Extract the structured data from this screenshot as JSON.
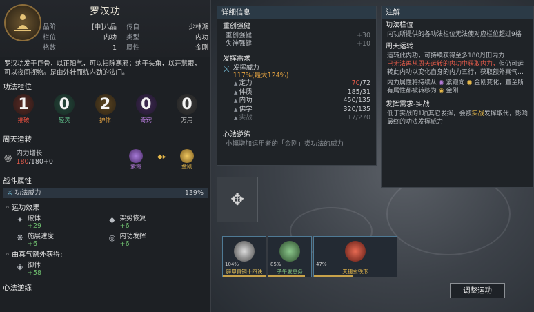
{
  "skill": {
    "title": "罗汉功",
    "attrs": [
      {
        "k": "品阶",
        "v": "[中]八品",
        "k2": "传自",
        "v2": "少林派"
      },
      {
        "k": "栏位",
        "v": "内功",
        "k2": "类型",
        "v2": "内功"
      },
      {
        "k": "格数",
        "v": "1",
        "k2": "属性",
        "v2": "金刚"
      }
    ],
    "desc": "罗汉功发于巨骨，以正阳气，可以扫除寒邪；纳于头角，以开慧眼，可以夜间视物。是由外壮而练内劲的法门。"
  },
  "slots_section": "功法栏位",
  "slots": [
    {
      "num": "1",
      "label": "摧破",
      "color": "#d84a3c"
    },
    {
      "num": "0",
      "label": "轻灵",
      "color": "#5fbf8a"
    },
    {
      "num": "2",
      "label": "护体",
      "color": "#e0a040"
    },
    {
      "num": "0",
      "label": "奇窍",
      "color": "#b47ad8"
    },
    {
      "num": "0",
      "label": "万用",
      "color": "#c8c8c8"
    }
  ],
  "cycle": {
    "section": "周天运转",
    "label": "内力增长",
    "value_now": "180",
    "value_rest": "/180+0",
    "from": "紫霞",
    "to": "金刚"
  },
  "combat": {
    "section": "战斗属性",
    "row_label": "功法威力",
    "row_value": "139%"
  },
  "effects": {
    "section": "运功效果",
    "items": [
      {
        "name": "破体",
        "value": "+29",
        "icon": "✦"
      },
      {
        "name": "架势恢复",
        "value": "+6",
        "icon": "◆"
      },
      {
        "name": "施展速度",
        "value": "+6",
        "icon": "❋"
      },
      {
        "name": "内功发挥",
        "value": "+6",
        "icon": "◎"
      }
    ],
    "extra_section": "由真气额外获得:",
    "extra": [
      {
        "name": "御体",
        "value": "+58",
        "icon": "◈"
      }
    ]
  },
  "bottom_section": "心法逆练",
  "detail": {
    "header": "详细信息",
    "section1": "重创强健",
    "rows": [
      {
        "k": "重创强健",
        "v": "+30"
      },
      {
        "k": "失神强健",
        "v": "+10"
      }
    ],
    "section2": "发挥需求",
    "power_label": "发挥威力",
    "power_value": "117%(最大124%)",
    "stats": [
      {
        "k": "定力",
        "now": "70",
        "max": "/72",
        "state": "red"
      },
      {
        "k": "体质",
        "now": "185",
        "max": "/31",
        "state": "ok"
      },
      {
        "k": "内功",
        "now": "450",
        "max": "/135",
        "state": "ok"
      },
      {
        "k": "佛学",
        "now": "320",
        "max": "/135",
        "state": "ok"
      },
      {
        "k": "实战",
        "now": "17",
        "max": "/270",
        "state": "dim"
      }
    ],
    "section3": "心法逆练",
    "reverse_text": "小幅增加运用者的「金刚」类功法的威力"
  },
  "notes": {
    "header": "注解",
    "s1": "功法栏位",
    "t1": "内功所提供的各功法栏位无法使对应栏位超过9格",
    "s2": "周天运转",
    "t2a": "运转此内功，可持续获得至多180丹田内力",
    "t2b": "已无法再从周天运转的内功中获取内力，",
    "t2c": "但仍可运转此内功以变化自身的内力五行，获取额外真气…",
    "t2d_pre": "内力属性将持续从",
    "t2d_a": "紫霞向",
    "t2d_b": "金刚变化，直至所有属性都被转移为",
    "t2d_c": "金刚",
    "s3": "发挥需求-实战",
    "t3_pre": "低于实战的1项其它发挥，会被",
    "t3_hl": "实战",
    "t3_post": "发挥取代，影响最终的功法发挥威力"
  },
  "cards": [
    {
      "pct": "104%",
      "name": "辟甲真铜十四诀",
      "color": "#dcdcdc",
      "fill": 1
    },
    {
      "pct": "85%",
      "name": "子午发息务",
      "color": "#6fa86f",
      "fill": 0.85
    },
    {
      "pct": "47%",
      "name": "天穗玄铁形",
      "color": "#d8503a",
      "fill": 0.47
    }
  ],
  "button_label": "调整运功"
}
